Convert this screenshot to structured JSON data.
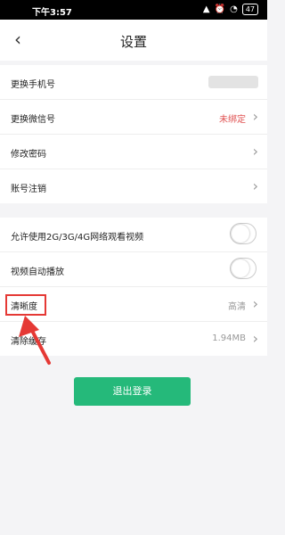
{
  "status_bar": {
    "time": "下午3:57",
    "battery": "47"
  },
  "header": {
    "title": "设置"
  },
  "account_section": {
    "items": [
      {
        "label": "更换手机号",
        "value": ""
      },
      {
        "label": "更换微信号",
        "value": "未绑定"
      },
      {
        "label": "修改密码",
        "value": ""
      },
      {
        "label": "账号注销",
        "value": ""
      }
    ]
  },
  "video_section": {
    "items": [
      {
        "label": "允许使用2G/3G/4G网络观看视频",
        "type": "toggle",
        "on": false
      },
      {
        "label": "视频自动播放",
        "type": "toggle",
        "on": false
      },
      {
        "label": "清晰度",
        "value": "高清"
      },
      {
        "label": "清除缓存",
        "value": "1.94MB"
      }
    ]
  },
  "logout_label": "退出登录",
  "colors": {
    "accent": "#25b97a",
    "unbound": "#e05252",
    "annotation": "#e53935"
  }
}
